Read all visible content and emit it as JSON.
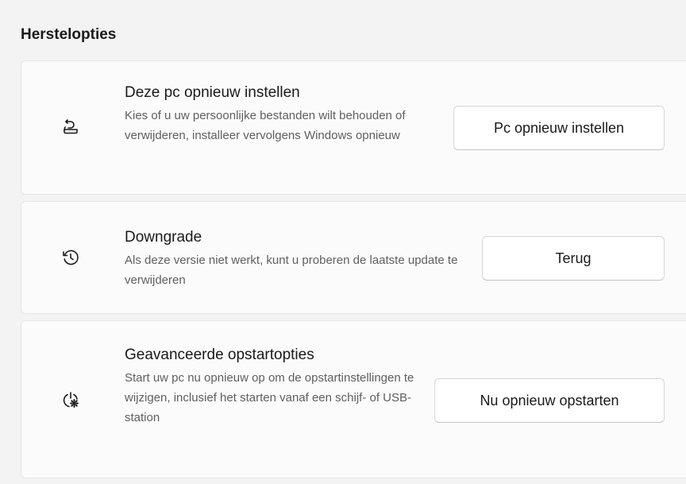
{
  "section": {
    "title": "Herstelopties"
  },
  "cards": [
    {
      "icon": "reset-pc-icon",
      "title": "Deze pc opnieuw instellen",
      "description": "Kies of u uw persoonlijke bestanden wilt behouden of verwijderen, installeer vervolgens Windows opnieuw",
      "button_label": "Pc opnieuw instellen"
    },
    {
      "icon": "history-icon",
      "title": "Downgrade",
      "description": "Als deze versie niet werkt, kunt u proberen de laatste update te verwijderen",
      "button_label": "Terug"
    },
    {
      "icon": "advanced-startup-icon",
      "title": "Geavanceerde opstartopties",
      "description": "Start uw pc nu opnieuw op om de opstartinstellingen te wijzigen, inclusief het starten vanaf een schijf- of USB-station",
      "button_label": "Nu opnieuw opstarten"
    }
  ]
}
